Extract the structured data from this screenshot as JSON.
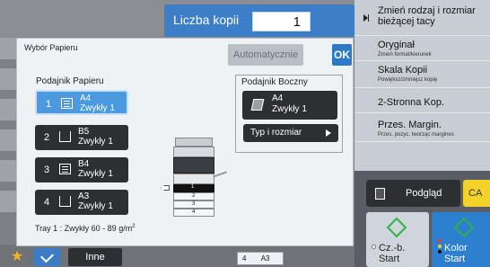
{
  "copies": {
    "label": "Liczba kopii",
    "value": "1"
  },
  "right_panel": {
    "items": [
      {
        "title": "Zmień rodzaj i rozmiar bieżącej tacy",
        "subtitle": ""
      },
      {
        "title": "Oryginał",
        "subtitle": "Zmień format/kierunek"
      },
      {
        "title": "Skala Kopii",
        "subtitle": "Powiększ/zmniejsz kopię"
      },
      {
        "title": "2-Stronna Kop.",
        "subtitle": ""
      },
      {
        "title": "Przes. Margin.",
        "subtitle": "Przes. pozyc. tworząc margines"
      }
    ],
    "preview_label": "Podgląd",
    "ca_label": "CA",
    "bw_start": {
      "line1": "Cz.-b.",
      "line2": "Start"
    },
    "color_start": {
      "line1": "Kolor",
      "line2": "Start"
    }
  },
  "dialog": {
    "title": "Wybór Papieru",
    "auto_label": "Automatycznie",
    "ok_label": "OK",
    "trays_heading": "Podajnik Papieru",
    "trays": [
      {
        "num": "1",
        "size": "A4",
        "type": "Zwykły 1",
        "icon": "paper-stack-icon",
        "selected": true
      },
      {
        "num": "2",
        "size": "B5",
        "type": "Zwykły 1",
        "icon": "tray-icon",
        "selected": false
      },
      {
        "num": "3",
        "size": "B4",
        "type": "Zwykły 1",
        "icon": "paper-stack-icon",
        "selected": false
      },
      {
        "num": "4",
        "size": "A3",
        "type": "Zwykły 1",
        "icon": "tray-icon",
        "selected": false
      }
    ],
    "tray_info_prefix": "Tray 1 : Zwykły 60 - 89 g/m",
    "tray_info_sup": "2",
    "bypass": {
      "heading": "Podajnik Boczny",
      "size": "A4",
      "type": "Zwykły 1",
      "type_size_label": "Typ i rozmiar"
    },
    "printer_tray_labels": [
      "1",
      "2",
      "3",
      "4"
    ]
  },
  "bottom_bar": {
    "inne_label": "Inne",
    "tray_strip_num": "4",
    "tray_strip_size": "A3"
  },
  "colors": {
    "accent_blue": "#2e79c6",
    "selected_tray": "#4b9ae0",
    "dark_button": "#2d2f33",
    "start_green": "#2fb24a",
    "ca_yellow": "#f3d22a"
  }
}
